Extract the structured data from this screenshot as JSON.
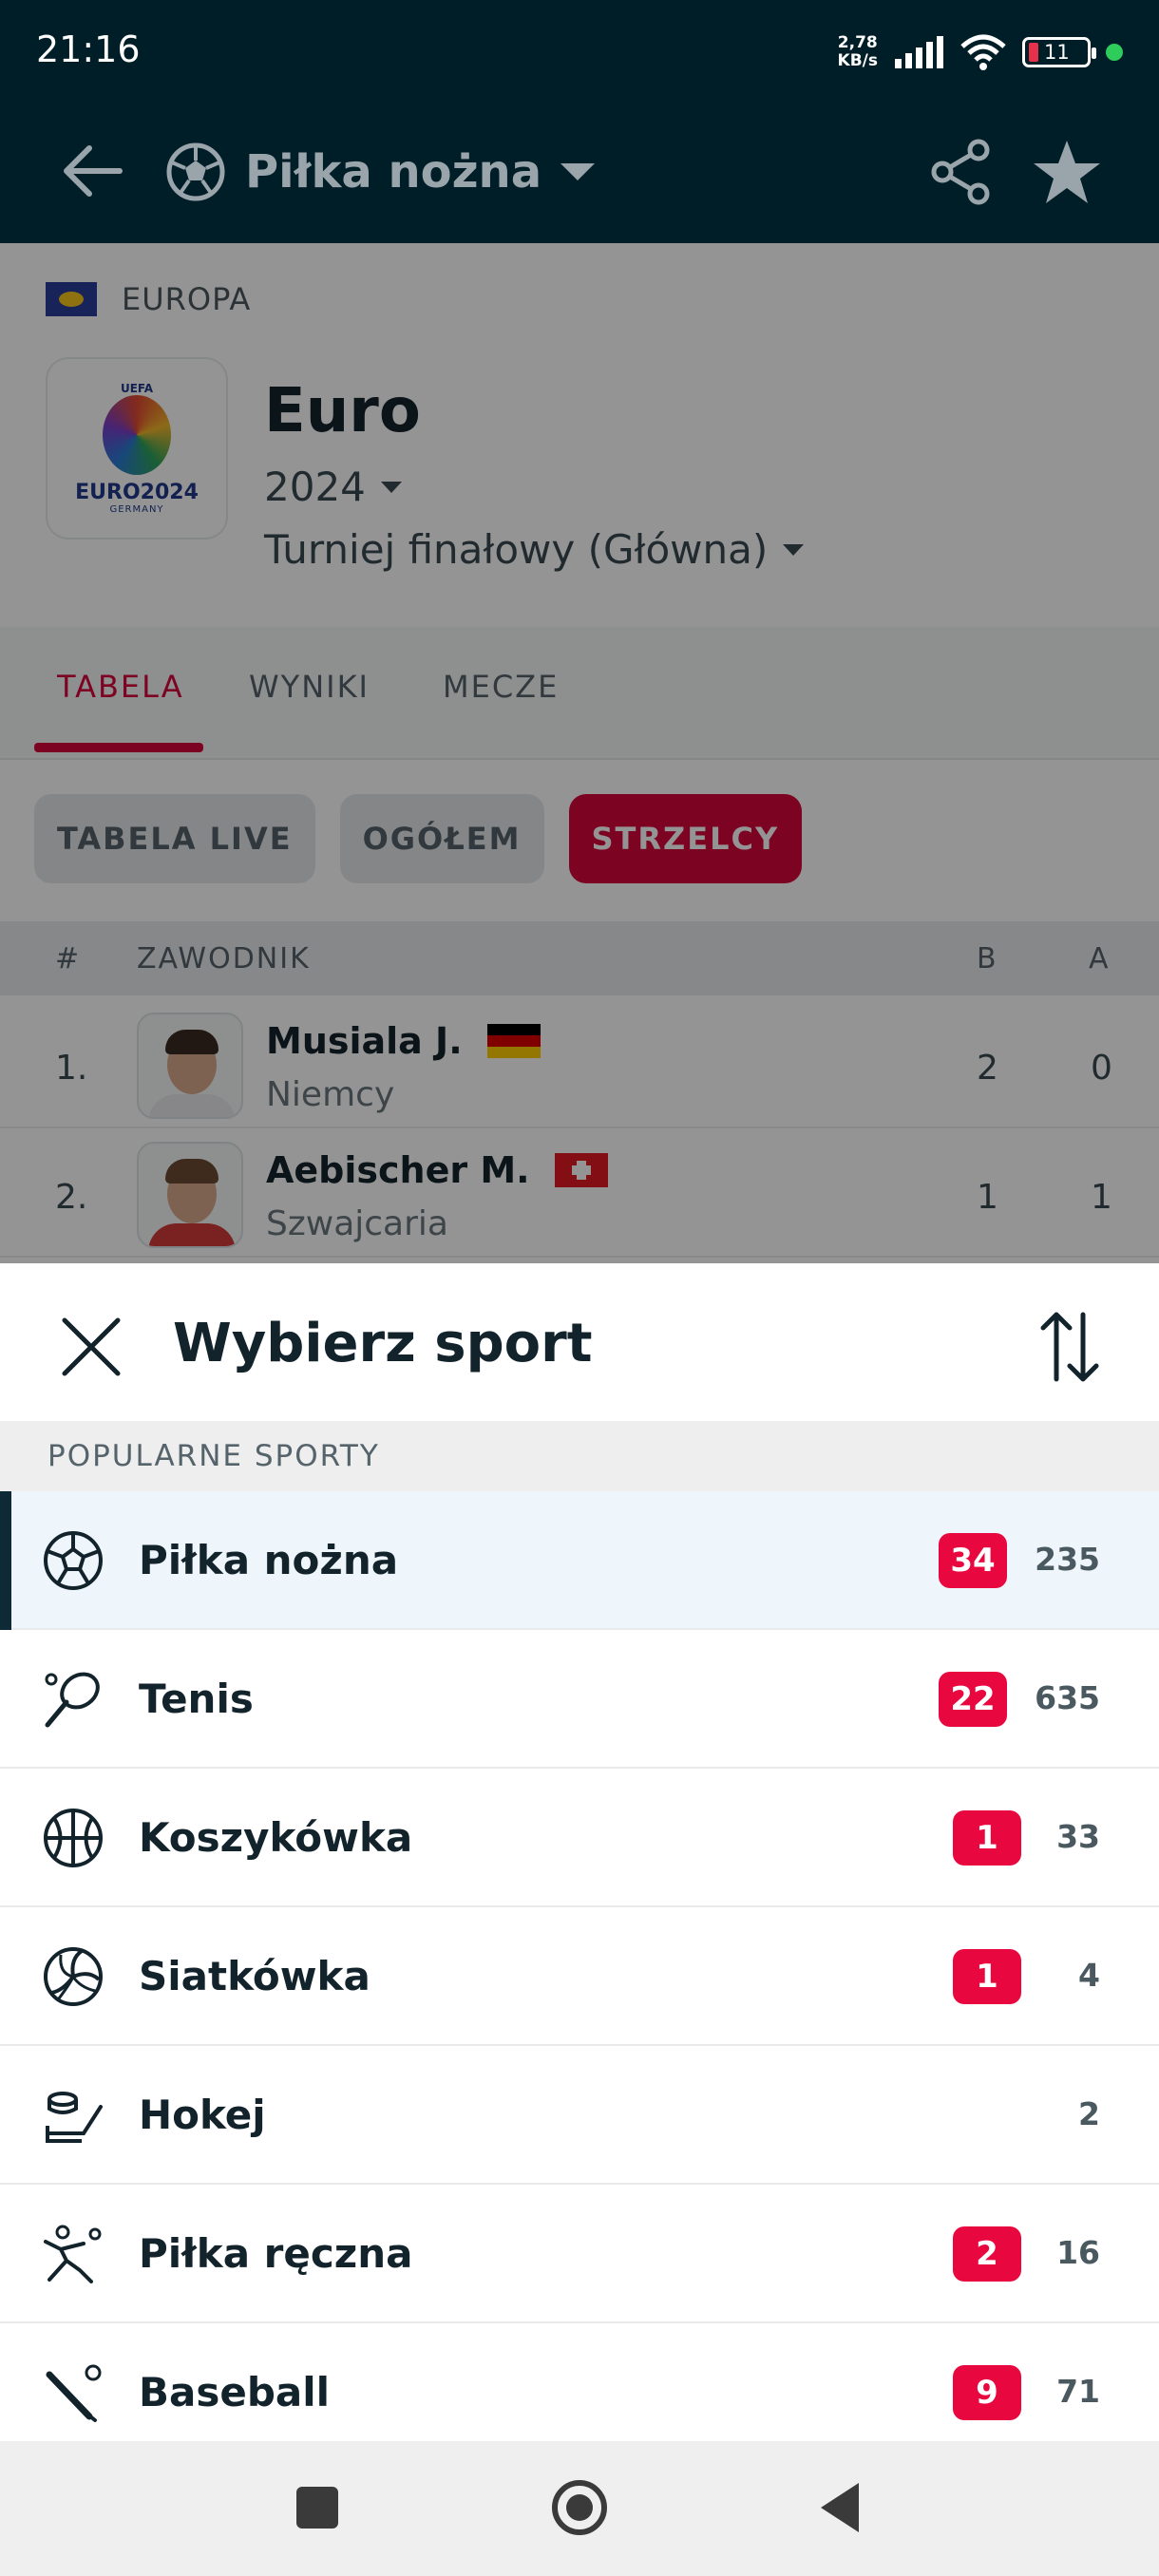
{
  "status_bar": {
    "time": "21:16",
    "speed_value": "2,78",
    "speed_unit": "KB/s",
    "battery": "11",
    "battery_color": "#e7304a",
    "icons": [
      "signal-icon",
      "wifi-icon",
      "battery-icon",
      "active-dot-icon"
    ]
  },
  "top_bar": {
    "sport_label": "Piłka nożna",
    "icons": [
      "back-arrow-icon",
      "soccer-ball-icon",
      "chevron-down-icon",
      "share-icon",
      "star-icon"
    ]
  },
  "competition": {
    "region": "EUROPA",
    "logo_text": "EURO2024",
    "logo_sub": "GERMANY",
    "logo_top": "UEFA",
    "name": "Euro",
    "year": "2024",
    "stage": "Turniej finałowy (Główna)"
  },
  "tabs": [
    {
      "label": "TABELA",
      "active": true
    },
    {
      "label": "WYNIKI",
      "active": false
    },
    {
      "label": "MECZE",
      "active": false
    }
  ],
  "chips": [
    {
      "label": "TABELA LIVE",
      "active": false
    },
    {
      "label": "OGÓŁEM",
      "active": false
    },
    {
      "label": "STRZELCY",
      "active": true
    }
  ],
  "table": {
    "headers": {
      "rank": "#",
      "player": "ZAWODNIK",
      "goals": "B",
      "assists": "A"
    },
    "rows": [
      {
        "rank": "1.",
        "name": "Musiala J.",
        "country": "Niemcy",
        "goals": "2",
        "assists": "0"
      },
      {
        "rank": "2.",
        "name": "Aebischer M.",
        "country": "Szwajcaria",
        "goals": "1",
        "assists": "1"
      }
    ]
  },
  "sheet": {
    "title": "Wybierz sport",
    "section": "POPULARNE SPORTY",
    "accent": "#e8083f",
    "sports": [
      {
        "name": "Piłka nożna",
        "live": "34",
        "total": "235",
        "icon": "soccer-ball-icon",
        "selected": true
      },
      {
        "name": "Tenis",
        "live": "22",
        "total": "635",
        "icon": "tennis-racket-icon",
        "selected": false
      },
      {
        "name": "Koszykówka",
        "live": "1",
        "total": "33",
        "icon": "basketball-icon",
        "selected": false
      },
      {
        "name": "Siatkówka",
        "live": "1",
        "total": "4",
        "icon": "volleyball-icon",
        "selected": false
      },
      {
        "name": "Hokej",
        "live": "",
        "total": "2",
        "icon": "hockey-icon",
        "selected": false
      },
      {
        "name": "Piłka ręczna",
        "live": "2",
        "total": "16",
        "icon": "handball-icon",
        "selected": false
      },
      {
        "name": "Baseball",
        "live": "9",
        "total": "71",
        "icon": "baseball-icon",
        "selected": false
      }
    ]
  }
}
